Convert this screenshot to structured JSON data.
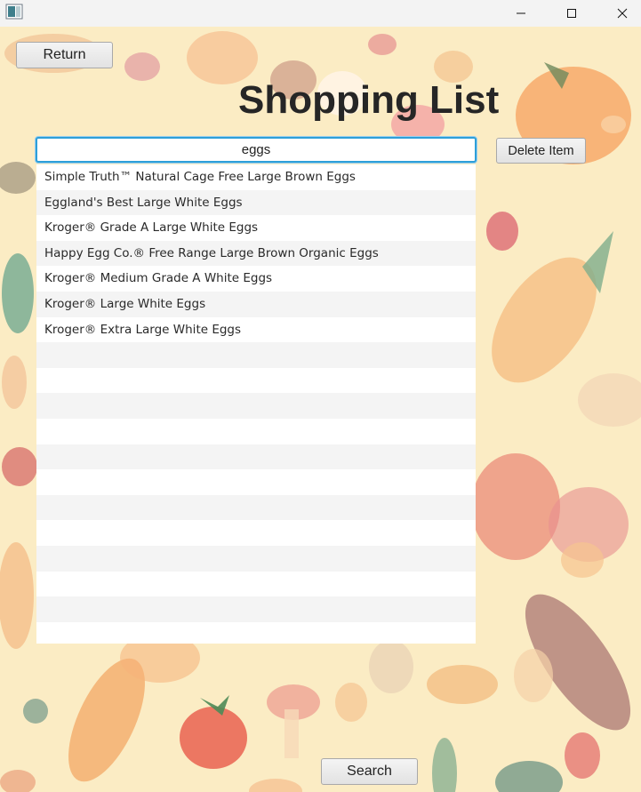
{
  "window": {
    "minimize_icon": "minimize-icon",
    "maximize_icon": "maximize-icon",
    "close_icon": "close-icon"
  },
  "header": {
    "return_label": "Return",
    "title": "Shopping List"
  },
  "search": {
    "value": "eggs",
    "delete_label": "Delete Item",
    "search_label": "Search"
  },
  "results": {
    "items": [
      "Simple Truth™ Natural Cage Free Large Brown Eggs",
      "Eggland's Best Large White Eggs",
      "Kroger® Grade A Large White Eggs",
      "Happy Egg Co.® Free Range Large Brown Organic Eggs",
      "Kroger® Medium Grade A White Eggs",
      "Kroger® Large White Eggs",
      "Kroger® Extra Large White Eggs",
      "",
      "",
      "",
      "",
      "",
      "",
      "",
      "",
      "",
      "",
      "",
      ""
    ]
  },
  "colors": {
    "background": "#fbecc4",
    "focus_border": "#2e9fd8"
  }
}
